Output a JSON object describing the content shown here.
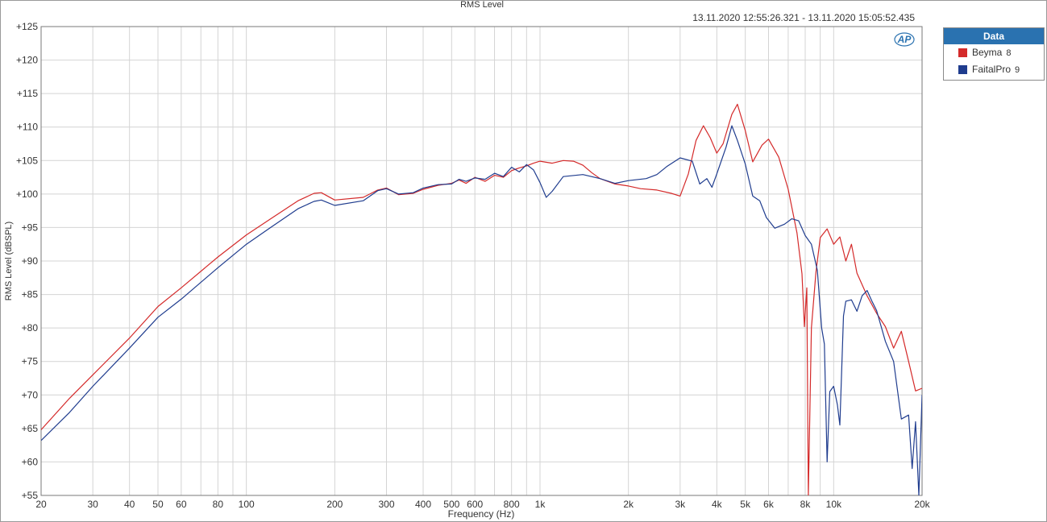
{
  "chart_data": {
    "type": "line",
    "title": "RMS Level",
    "subtitle": "13.11.2020 12:55:26.321 - 13.11.2020 15:05:52.435",
    "xlabel": "Frequency (Hz)",
    "ylabel": "RMS Level (dBSPL)",
    "xscale": "log",
    "xlim": [
      20,
      20000
    ],
    "ylim": [
      55,
      125
    ],
    "grid": true,
    "legend_title": "Data",
    "legend_position": "top-right-outside",
    "x_ticks": [
      {
        "value": 20,
        "label": "20"
      },
      {
        "value": 30,
        "label": "30"
      },
      {
        "value": 40,
        "label": "40"
      },
      {
        "value": 50,
        "label": "50"
      },
      {
        "value": 60,
        "label": "60"
      },
      {
        "value": 80,
        "label": "80"
      },
      {
        "value": 100,
        "label": "100"
      },
      {
        "value": 200,
        "label": "200"
      },
      {
        "value": 300,
        "label": "300"
      },
      {
        "value": 400,
        "label": "400"
      },
      {
        "value": 500,
        "label": "500"
      },
      {
        "value": 600,
        "label": "600"
      },
      {
        "value": 800,
        "label": "800"
      },
      {
        "value": 1000,
        "label": "1k"
      },
      {
        "value": 2000,
        "label": "2k"
      },
      {
        "value": 3000,
        "label": "3k"
      },
      {
        "value": 4000,
        "label": "4k"
      },
      {
        "value": 5000,
        "label": "5k"
      },
      {
        "value": 6000,
        "label": "6k"
      },
      {
        "value": 8000,
        "label": "8k"
      },
      {
        "value": 10000,
        "label": "10k"
      },
      {
        "value": 20000,
        "label": "20k"
      }
    ],
    "y_ticks": [
      {
        "value": 125,
        "label": "+125"
      },
      {
        "value": 120,
        "label": "+120"
      },
      {
        "value": 115,
        "label": "+115"
      },
      {
        "value": 110,
        "label": "+110"
      },
      {
        "value": 105,
        "label": "+105"
      },
      {
        "value": 100,
        "label": "+100"
      },
      {
        "value": 95,
        "label": "+95"
      },
      {
        "value": 90,
        "label": "+90"
      },
      {
        "value": 85,
        "label": "+85"
      },
      {
        "value": 80,
        "label": "+80"
      },
      {
        "value": 75,
        "label": "+75"
      },
      {
        "value": 70,
        "label": "+70"
      },
      {
        "value": 65,
        "label": "+65"
      },
      {
        "value": 60,
        "label": "+60"
      },
      {
        "value": 55,
        "label": "+55"
      }
    ],
    "series": [
      {
        "name": "Beyma",
        "number": "8",
        "color": "#d42a2a",
        "points": [
          [
            20,
            64.8
          ],
          [
            25,
            69.5
          ],
          [
            30,
            73.0
          ],
          [
            40,
            78.5
          ],
          [
            50,
            83.2
          ],
          [
            60,
            86.0
          ],
          [
            80,
            90.6
          ],
          [
            100,
            93.9
          ],
          [
            120,
            96.2
          ],
          [
            150,
            99.0
          ],
          [
            170,
            100.1
          ],
          [
            180,
            100.2
          ],
          [
            200,
            99.1
          ],
          [
            250,
            99.5
          ],
          [
            280,
            100.6
          ],
          [
            300,
            100.9
          ],
          [
            330,
            99.9
          ],
          [
            370,
            100.1
          ],
          [
            400,
            100.7
          ],
          [
            450,
            101.3
          ],
          [
            500,
            101.6
          ],
          [
            530,
            102.1
          ],
          [
            560,
            101.6
          ],
          [
            600,
            102.5
          ],
          [
            650,
            101.9
          ],
          [
            700,
            102.8
          ],
          [
            750,
            102.5
          ],
          [
            800,
            103.5
          ],
          [
            850,
            103.9
          ],
          [
            900,
            104.2
          ],
          [
            950,
            104.6
          ],
          [
            1000,
            104.9
          ],
          [
            1100,
            104.6
          ],
          [
            1200,
            105.0
          ],
          [
            1300,
            104.9
          ],
          [
            1400,
            104.3
          ],
          [
            1500,
            103.2
          ],
          [
            1600,
            102.3
          ],
          [
            1800,
            101.5
          ],
          [
            2000,
            101.2
          ],
          [
            2200,
            100.8
          ],
          [
            2500,
            100.6
          ],
          [
            2800,
            100.1
          ],
          [
            3000,
            99.7
          ],
          [
            3200,
            103.0
          ],
          [
            3400,
            108.0
          ],
          [
            3600,
            110.2
          ],
          [
            3800,
            108.4
          ],
          [
            4000,
            106.1
          ],
          [
            4200,
            107.5
          ],
          [
            4500,
            111.9
          ],
          [
            4700,
            113.4
          ],
          [
            5000,
            109.5
          ],
          [
            5300,
            104.8
          ],
          [
            5700,
            107.3
          ],
          [
            6000,
            108.2
          ],
          [
            6500,
            105.5
          ],
          [
            7000,
            100.7
          ],
          [
            7500,
            94.2
          ],
          [
            7800,
            88.1
          ],
          [
            7950,
            80.2
          ],
          [
            8100,
            86.0
          ],
          [
            8200,
            55.0
          ],
          [
            8400,
            80.0
          ],
          [
            8700,
            88.3
          ],
          [
            9000,
            93.5
          ],
          [
            9500,
            94.8
          ],
          [
            10000,
            92.5
          ],
          [
            10500,
            93.6
          ],
          [
            11000,
            90.0
          ],
          [
            11500,
            92.5
          ],
          [
            12000,
            88.2
          ],
          [
            13000,
            84.8
          ],
          [
            14000,
            82.2
          ],
          [
            15000,
            80.2
          ],
          [
            16000,
            77.0
          ],
          [
            17000,
            79.5
          ],
          [
            18000,
            75.0
          ],
          [
            19000,
            70.6
          ],
          [
            20000,
            71.0
          ]
        ]
      },
      {
        "name": "FaitalPro",
        "number": "9",
        "color": "#1f3c8e",
        "points": [
          [
            20,
            63.2
          ],
          [
            25,
            67.4
          ],
          [
            30,
            71.3
          ],
          [
            40,
            77.0
          ],
          [
            50,
            81.6
          ],
          [
            60,
            84.3
          ],
          [
            80,
            89.0
          ],
          [
            100,
            92.5
          ],
          [
            120,
            94.9
          ],
          [
            150,
            97.8
          ],
          [
            170,
            98.9
          ],
          [
            180,
            99.1
          ],
          [
            200,
            98.3
          ],
          [
            250,
            99.0
          ],
          [
            280,
            100.5
          ],
          [
            300,
            100.8
          ],
          [
            330,
            100.0
          ],
          [
            370,
            100.2
          ],
          [
            400,
            100.9
          ],
          [
            450,
            101.4
          ],
          [
            500,
            101.5
          ],
          [
            530,
            102.2
          ],
          [
            560,
            101.9
          ],
          [
            600,
            102.4
          ],
          [
            650,
            102.2
          ],
          [
            700,
            103.1
          ],
          [
            750,
            102.6
          ],
          [
            800,
            104.0
          ],
          [
            850,
            103.3
          ],
          [
            900,
            104.4
          ],
          [
            950,
            103.6
          ],
          [
            1000,
            101.7
          ],
          [
            1050,
            99.5
          ],
          [
            1100,
            100.4
          ],
          [
            1200,
            102.6
          ],
          [
            1400,
            102.9
          ],
          [
            1600,
            102.3
          ],
          [
            1800,
            101.6
          ],
          [
            2000,
            102.0
          ],
          [
            2300,
            102.3
          ],
          [
            2500,
            102.9
          ],
          [
            2700,
            104.1
          ],
          [
            3000,
            105.4
          ],
          [
            3300,
            104.9
          ],
          [
            3500,
            101.5
          ],
          [
            3700,
            102.3
          ],
          [
            3850,
            101.0
          ],
          [
            4000,
            103.0
          ],
          [
            4300,
            107.0
          ],
          [
            4500,
            110.2
          ],
          [
            4700,
            108.0
          ],
          [
            5000,
            104.5
          ],
          [
            5300,
            99.7
          ],
          [
            5600,
            99.0
          ],
          [
            5900,
            96.5
          ],
          [
            6300,
            94.9
          ],
          [
            6800,
            95.5
          ],
          [
            7200,
            96.3
          ],
          [
            7600,
            96.0
          ],
          [
            8000,
            93.8
          ],
          [
            8400,
            92.5
          ],
          [
            8800,
            88.6
          ],
          [
            9100,
            80.0
          ],
          [
            9300,
            77.6
          ],
          [
            9500,
            60.0
          ],
          [
            9700,
            70.5
          ],
          [
            10000,
            71.3
          ],
          [
            10300,
            68.5
          ],
          [
            10500,
            65.5
          ],
          [
            10800,
            81.8
          ],
          [
            11000,
            84.0
          ],
          [
            11500,
            84.2
          ],
          [
            12000,
            82.5
          ],
          [
            12500,
            84.8
          ],
          [
            13000,
            85.6
          ],
          [
            13500,
            84.0
          ],
          [
            14000,
            82.6
          ],
          [
            15000,
            78.0
          ],
          [
            16000,
            75.0
          ],
          [
            17000,
            66.4
          ],
          [
            18000,
            67.0
          ],
          [
            18500,
            59.0
          ],
          [
            19000,
            66.0
          ],
          [
            19500,
            55.0
          ],
          [
            20000,
            70.0
          ]
        ]
      }
    ]
  },
  "ap_logo_text": "AP"
}
